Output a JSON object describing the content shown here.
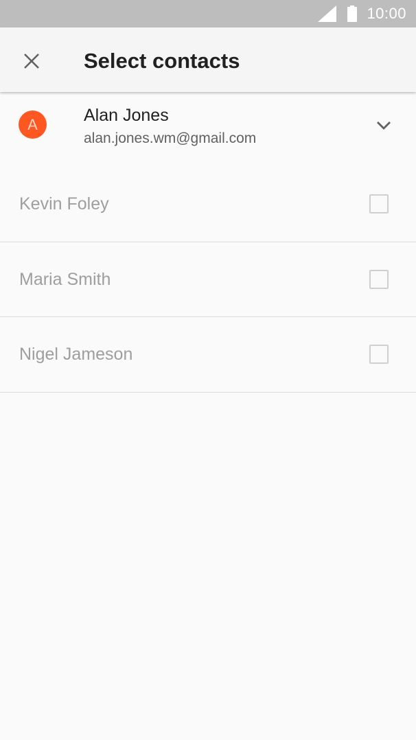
{
  "status_bar": {
    "time": "10:00",
    "icons": [
      "signal-icon",
      "battery-icon"
    ]
  },
  "app_bar": {
    "close_icon": "close-icon",
    "title": "Select contacts"
  },
  "account": {
    "avatar_letter": "A",
    "avatar_color": "#ff5722",
    "name": "Alan Jones",
    "email": "alan.jones.wm@gmail.com",
    "expand_icon": "chevron-down-icon"
  },
  "contacts": [
    {
      "name": "Kevin Foley",
      "checked": false
    },
    {
      "name": "Maria Smith",
      "checked": false
    },
    {
      "name": "Nigel Jameson",
      "checked": false
    }
  ]
}
